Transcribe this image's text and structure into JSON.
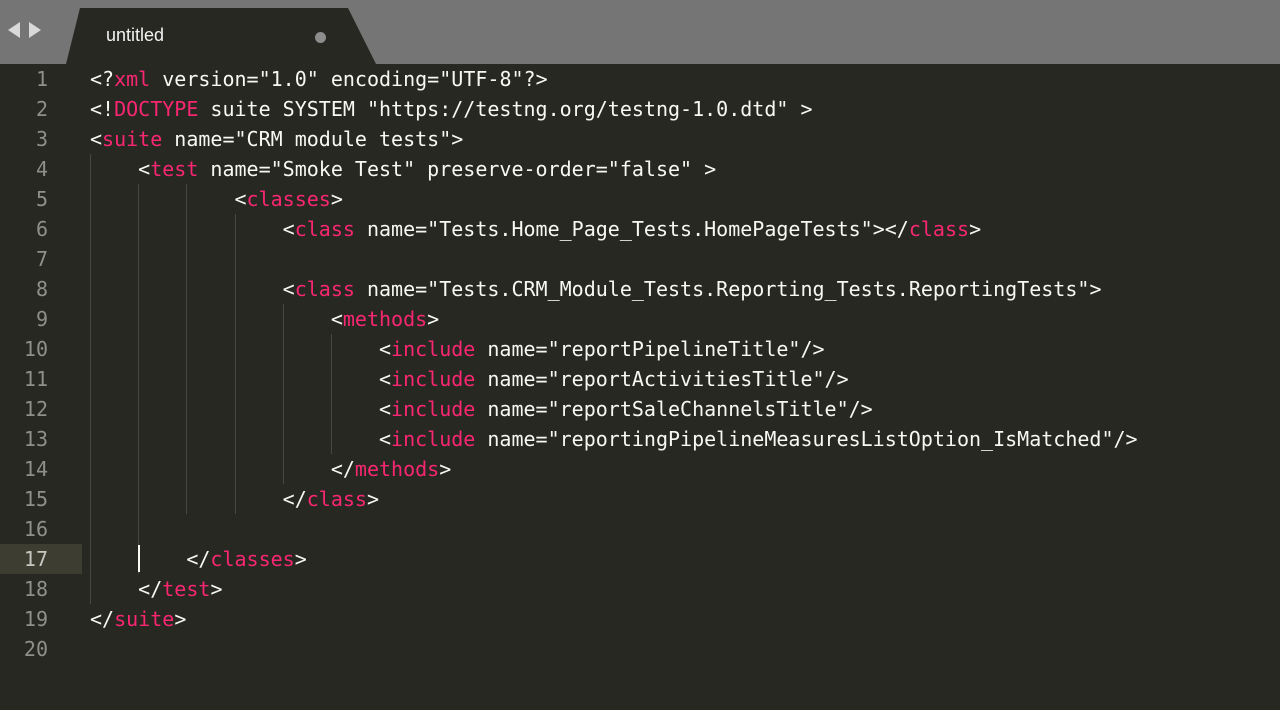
{
  "colors": {
    "tabbar_bg": "#757575",
    "editor_bg": "#272822",
    "line_number": "#8f908a",
    "tag": "#f92672",
    "attribute": "#a6e22e",
    "string": "#e6db74",
    "plain": "#f8f8f2",
    "current_line": "#3e3d32"
  },
  "tabbar": {
    "back_icon": "triangle-left-icon",
    "forward_icon": "triangle-right-icon",
    "tab_title": "untitled",
    "dirty_indicator_icon": "unsaved-dot-icon"
  },
  "editor": {
    "current_line": 17,
    "lines": [
      {
        "num": "1",
        "code": "<?xml version=\"1.0\" encoding=\"UTF-8\"?>"
      },
      {
        "num": "2",
        "code": "<!DOCTYPE suite SYSTEM \"https://testng.org/testng-1.0.dtd\" >"
      },
      {
        "num": "3",
        "code": "<suite name=\"CRM module tests\">"
      },
      {
        "num": "4",
        "code": "    <test name=\"Smoke Test\" preserve-order=\"false\" >"
      },
      {
        "num": "5",
        "code": "            <classes>"
      },
      {
        "num": "6",
        "code": "                <class name=\"Tests.Home_Page_Tests.HomePageTests\"></class>"
      },
      {
        "num": "7",
        "code": ""
      },
      {
        "num": "8",
        "code": "                <class name=\"Tests.CRM_Module_Tests.Reporting_Tests.ReportingTests\">"
      },
      {
        "num": "9",
        "code": "                    <methods>"
      },
      {
        "num": "10",
        "code": "                        <include name=\"reportPipelineTitle\"/>"
      },
      {
        "num": "11",
        "code": "                        <include name=\"reportActivitiesTitle\"/>"
      },
      {
        "num": "12",
        "code": "                        <include name=\"reportSaleChannelsTitle\"/>"
      },
      {
        "num": "13",
        "code": "                        <include name=\"reportingPipelineMeasuresListOption_IsMatched\"/>"
      },
      {
        "num": "14",
        "code": "                    </methods>"
      },
      {
        "num": "15",
        "code": "                </class>"
      },
      {
        "num": "16",
        "code": ""
      },
      {
        "num": "17",
        "code": "        </classes>"
      },
      {
        "num": "18",
        "code": "    </test>"
      },
      {
        "num": "19",
        "code": "</suite>"
      },
      {
        "num": "20",
        "code": ""
      }
    ]
  }
}
